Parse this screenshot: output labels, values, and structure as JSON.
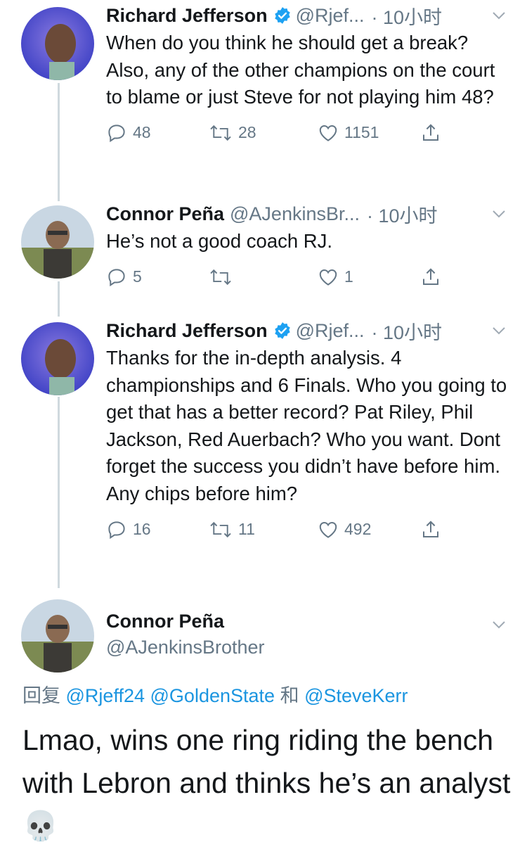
{
  "tweets": [
    {
      "name": "Richard Jefferson",
      "verified": true,
      "handle": "@Rjef...",
      "time": "· 10小时",
      "text": "When do you think he should get a break? Also, any of the other champions on the court to blame or just Steve for not playing him 48?",
      "replies": "48",
      "retweets": "28",
      "likes": "1151"
    },
    {
      "name": "Connor Peña",
      "verified": false,
      "handle": "@AJenkinsBr...",
      "time": "· 10小时",
      "text": "He’s not a good coach RJ.",
      "replies": "5",
      "retweets": "",
      "likes": "1"
    },
    {
      "name": "Richard Jefferson",
      "verified": true,
      "handle": "@Rjef...",
      "time": "· 10小时",
      "text": "Thanks for the in-depth analysis. 4 championships and 6 Finals. Who you going to get that has a better record? Pat Riley, Phil Jackson, Red Auerbach? Who you want. Dont forget the success you didn’t have before him. Any chips before him?",
      "replies": "16",
      "retweets": "11",
      "likes": "492"
    }
  ],
  "focused": {
    "name": "Connor Peña",
    "handle": "@AJenkinsBrother",
    "reply_prefix": "回复",
    "mentions": [
      "@Rjeff24",
      "@GoldenState",
      "@SteveKerr"
    ],
    "conjunction": "和",
    "text": "Lmao, wins one ring riding the bench with Lebron and thinks he’s an analyst",
    "emoji": "💀"
  },
  "colors": {
    "text": "#14171a",
    "secondary": "#657786",
    "link": "#1b95e0",
    "verified": "#1da1f2",
    "thread_line": "#cfd9de"
  }
}
